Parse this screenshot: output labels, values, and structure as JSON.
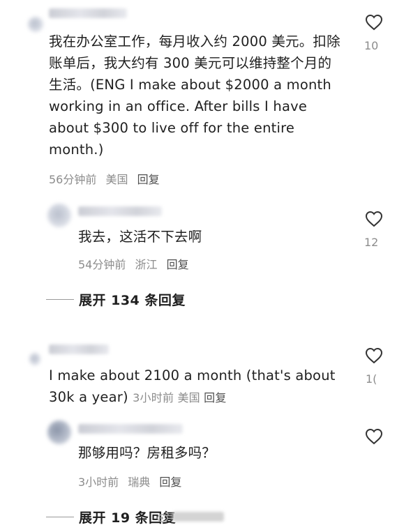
{
  "comments": [
    {
      "text": "我在办公室工作，每月收入约 2000 美元。扣除账单后，我大约有 300 美元可以维持整个月的生活。(ENG I make about $2000 a month working in an office. After bills I have about $300 to live off for the entire month.)",
      "time": "56分钟前",
      "location": "美国",
      "reply_label": "回复",
      "like_count": "10"
    },
    {
      "text": "我去，这活不下去啊",
      "time": "54分钟前",
      "location": "浙江",
      "reply_label": "回复",
      "like_count": "12"
    },
    {
      "expand_label": "展开 134 条回复"
    },
    {
      "text": "I make about 2100 a month (that's about 30k a year)",
      "time": "3小时前",
      "location": "美国",
      "reply_label": "回复",
      "like_count": "1("
    },
    {
      "text": "那够用吗？房租多吗？",
      "time": "3小时前",
      "location": "瑞典",
      "reply_label": "回复"
    },
    {
      "expand_label": "展开 19 条回复"
    }
  ],
  "colors": {
    "text": "#1f1f1f",
    "meta": "#8c8c8c",
    "reply": "#4f4f4f"
  },
  "icons": [
    "heart-outline-icon",
    "weibo-watermark-icon"
  ]
}
